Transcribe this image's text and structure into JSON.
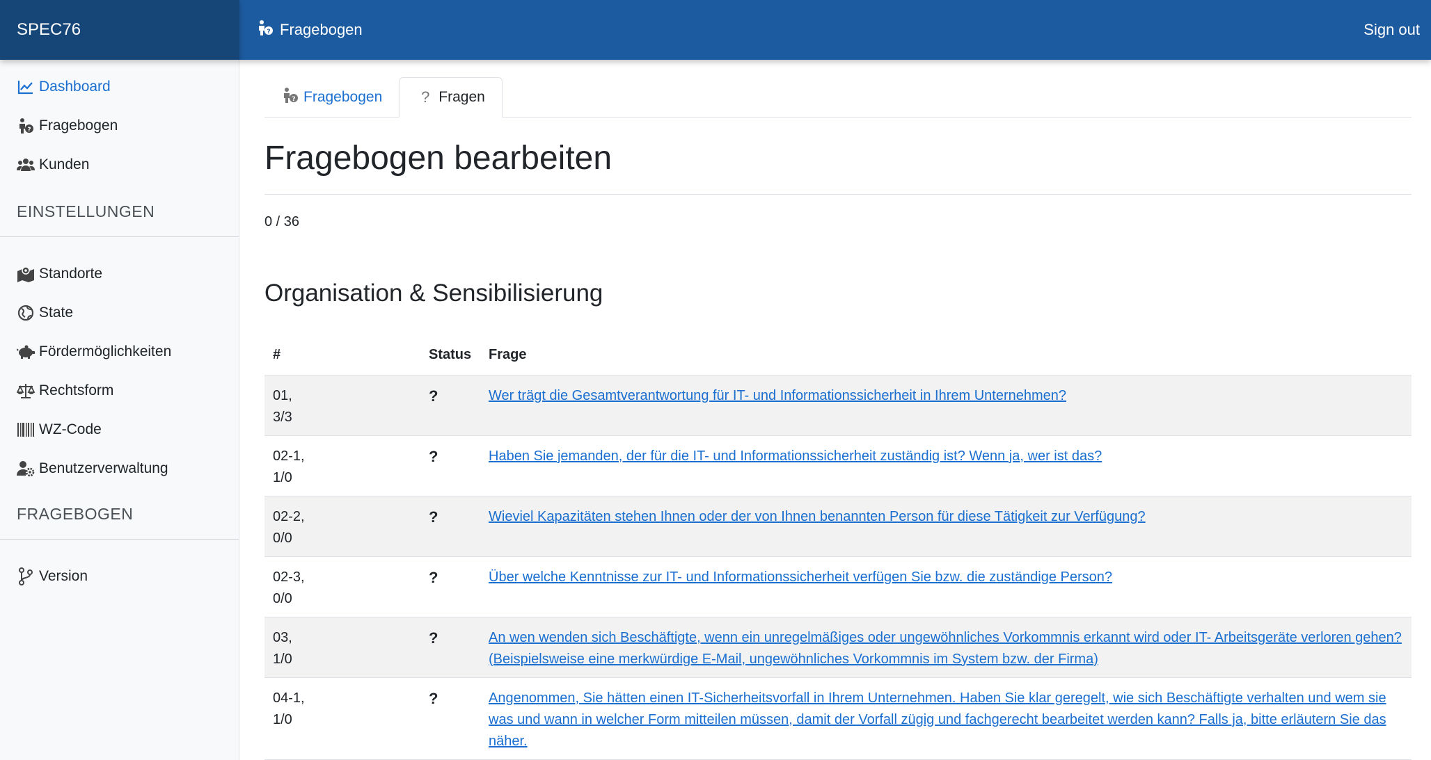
{
  "brand": "SPEC76",
  "topbar": {
    "title": "Fragebogen",
    "signout": "Sign out",
    "title_icon": "person-question-icon"
  },
  "sidebar": {
    "items": [
      {
        "label": "Dashboard",
        "icon": "chart-line-icon"
      },
      {
        "label": "Fragebogen",
        "icon": "person-question-icon"
      },
      {
        "label": "Kunden",
        "icon": "users-icon"
      }
    ],
    "section1": "EINSTELLUNGEN",
    "settings": [
      {
        "label": "Standorte",
        "icon": "map-marker-icon"
      },
      {
        "label": "State",
        "icon": "globe-icon"
      },
      {
        "label": "Fördermöglichkeiten",
        "icon": "piggy-bank-icon"
      },
      {
        "label": "Rechtsform",
        "icon": "scale-icon"
      },
      {
        "label": "WZ-Code",
        "icon": "barcode-icon"
      },
      {
        "label": "Benutzerverwaltung",
        "icon": "user-cog-icon"
      }
    ],
    "section2": "FRAGEBOGEN",
    "fragebogen": [
      {
        "label": "Version",
        "icon": "branch-icon"
      }
    ]
  },
  "tabs": [
    {
      "label": "Fragebogen",
      "icon": "person-question-icon"
    },
    {
      "label": "Fragen",
      "icon": "question-icon"
    }
  ],
  "page_title": "Fragebogen bearbeiten",
  "counter": "0 / 36",
  "section_title": "Organisation & Sensibilisierung",
  "table": {
    "headers": [
      "#",
      "Status",
      "Frage"
    ],
    "rows": [
      {
        "num1": "01,",
        "num2": "3/3",
        "status": "?",
        "frage": "Wer trägt die Gesamtverantwortung für IT- und Informationssicherheit in Ihrem Unternehmen?"
      },
      {
        "num1": "02-1,",
        "num2": "1/0",
        "status": "?",
        "frage": "Haben Sie jemanden, der für die IT- und Informationssicherheit zuständig ist? Wenn ja, wer ist das?"
      },
      {
        "num1": "02-2,",
        "num2": "0/0",
        "status": "?",
        "frage": "Wieviel Kapazitäten stehen Ihnen oder der von Ihnen benannten Person für diese Tätigkeit zur Verfügung?"
      },
      {
        "num1": "02-3,",
        "num2": "0/0",
        "status": "?",
        "frage": "Über welche Kenntnisse zur IT- und Informationssicherheit verfügen Sie bzw. die zuständige Person?"
      },
      {
        "num1": "03,",
        "num2": "1/0",
        "status": "?",
        "frage": "An wen wenden sich Beschäftigte, wenn ein unregelmäßiges oder ungewöhnliches Vorkommnis erkannt wird oder IT- Arbeitsgeräte verloren gehen? (Beispielsweise eine merkwürdige E-Mail, ungewöhnliches Vorkommnis im System bzw. der Firma)"
      },
      {
        "num1": "04-1,",
        "num2": "1/0",
        "status": "?",
        "frage": "Angenommen, Sie hätten einen IT-Sicherheitsvorfall in Ihrem Unternehmen. Haben Sie klar geregelt, wie sich Beschäftigte verhalten und wem sie was und wann in welcher Form mitteilen müssen, damit der Vorfall zügig und fachgerecht bearbeitet werden kann? Falls ja, bitte erläutern Sie das näher."
      }
    ]
  },
  "colors": {
    "brand_bg": "#164678",
    "topbar_bg": "#1d5ba1",
    "link": "#1a6fd0",
    "stripe": "#f2f2f2"
  }
}
